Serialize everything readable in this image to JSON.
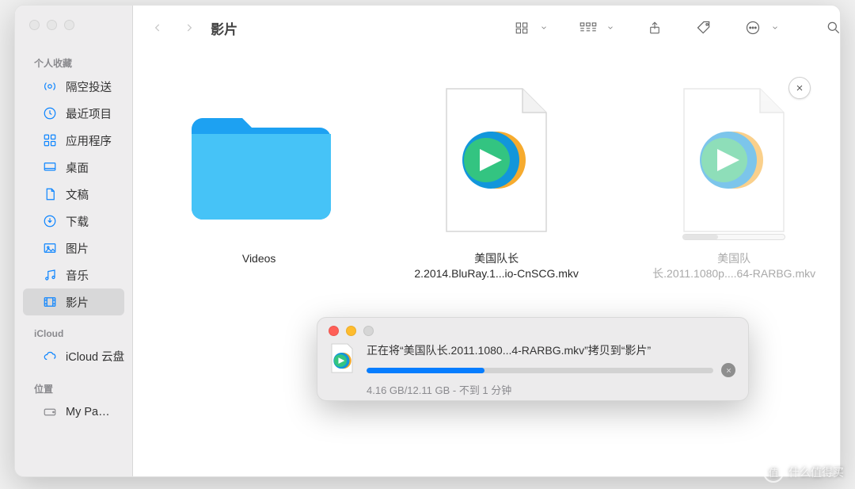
{
  "window": {
    "title": "影片"
  },
  "sidebar": {
    "sections": [
      {
        "label": "个人收藏",
        "items": [
          {
            "icon": "airdrop",
            "label": "隔空投送"
          },
          {
            "icon": "clock",
            "label": "最近项目"
          },
          {
            "icon": "apps",
            "label": "应用程序"
          },
          {
            "icon": "desktop",
            "label": "桌面"
          },
          {
            "icon": "doc",
            "label": "文稿"
          },
          {
            "icon": "download",
            "label": "下载"
          },
          {
            "icon": "image",
            "label": "图片"
          },
          {
            "icon": "music",
            "label": "音乐"
          },
          {
            "icon": "movie",
            "label": "影片",
            "active": true
          }
        ]
      },
      {
        "label": "iCloud",
        "items": [
          {
            "icon": "cloud",
            "label": "iCloud 云盘"
          }
        ]
      },
      {
        "label": "位置",
        "items": [
          {
            "icon": "disk",
            "label": "My Pa…",
            "gray": true
          }
        ]
      }
    ]
  },
  "files": [
    {
      "type": "folder",
      "name_line1": "Videos",
      "name_line2": ""
    },
    {
      "type": "video",
      "name_line1": "美国队长",
      "name_line2": "2.2014.BluRay.1...io-CnSCG.mkv"
    },
    {
      "type": "video",
      "name_line1": "美国队",
      "name_line2": "长.2011.1080p....64-RARBG.mkv",
      "transferring": true
    }
  ],
  "progress": {
    "title": "正在将“美国队长.2011.1080...4-RARBG.mkv”拷贝到“影片”",
    "sub": "4.16 GB/12.11 GB - 不到 1 分钟",
    "percent": 34
  },
  "watermark": "什么值得买"
}
